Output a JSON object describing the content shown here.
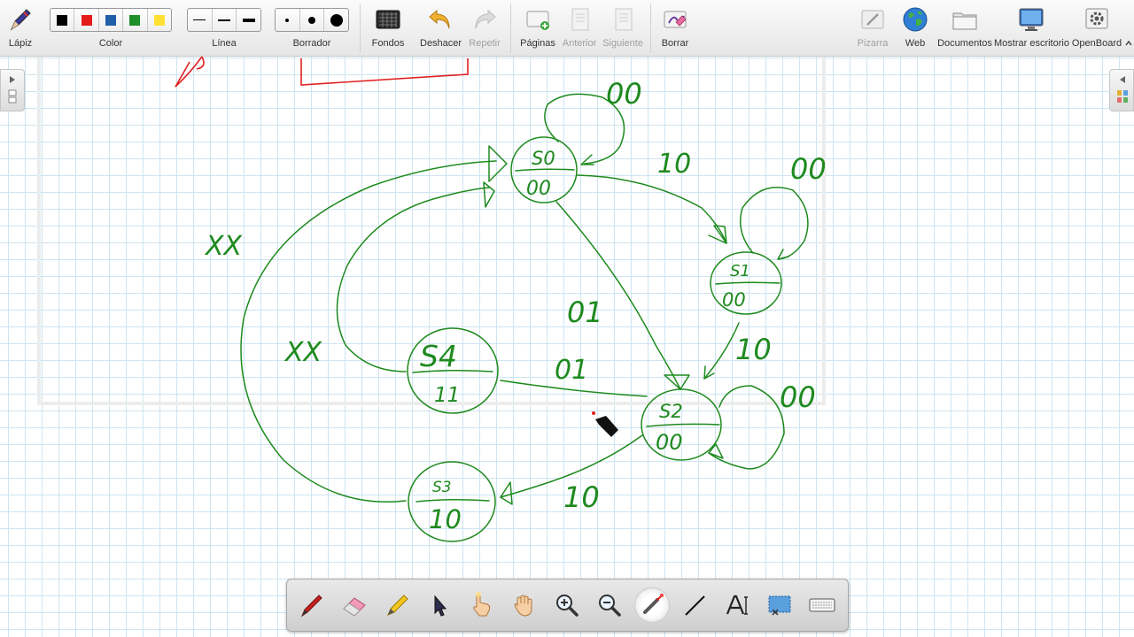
{
  "toolbar": {
    "pen_label": "Lápiz",
    "color_label": "Color",
    "line_label": "Línea",
    "eraser_label": "Borrador",
    "backgrounds_label": "Fondos",
    "undo_label": "Deshacer",
    "redo_label": "Repetir",
    "pages_label": "Páginas",
    "previous_label": "Anterior",
    "next_label": "Siguiente",
    "clear_label": "Borrar",
    "board_label": "Pizarra",
    "web_label": "Web",
    "documents_label": "Documentos",
    "desktop_label": "Mostrar escritorio",
    "openboard_label": "OpenBoard"
  },
  "colors": {
    "palette": [
      "#000000",
      "#e31b1b",
      "#1f5fa8",
      "#1f8f2a",
      "#ffe033"
    ],
    "ink_green": "#1e8a1e",
    "ink_red": "#e02020",
    "grid": "#cfe4f2"
  },
  "dock": {
    "tools": [
      "pen-icon",
      "eraser-icon",
      "highlighter-icon",
      "select-arrow-icon",
      "interact-hand-icon",
      "pan-hand-icon",
      "zoom-in-icon",
      "zoom-out-icon",
      "laser-pointer-icon",
      "line-tool-icon",
      "text-tool-icon",
      "capture-icon",
      "keyboard-icon"
    ],
    "active_tool": "laser-pointer-icon"
  },
  "drawing": {
    "states": [
      {
        "top": "S0",
        "bottom": "00"
      },
      {
        "top": "S1",
        "bottom": "00"
      },
      {
        "top": "S2",
        "bottom": "00"
      },
      {
        "top": "S3",
        "bottom": "10"
      },
      {
        "top": "S4",
        "bottom": "11"
      }
    ],
    "transitions": [
      "00",
      "10",
      "00",
      "01",
      "10",
      "00",
      "01",
      "10",
      "XX",
      "XX"
    ]
  }
}
